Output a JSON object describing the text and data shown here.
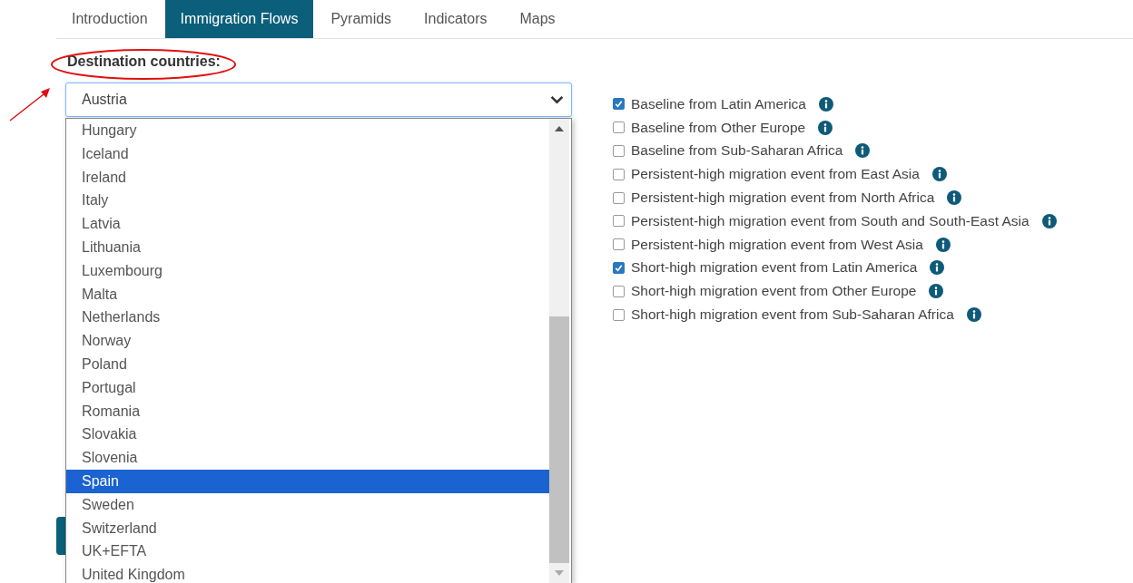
{
  "tabs": [
    {
      "label": "Introduction",
      "selected": false
    },
    {
      "label": "Immigration Flows",
      "selected": true
    },
    {
      "label": "Pyramids",
      "selected": false
    },
    {
      "label": "Indicators",
      "selected": false
    },
    {
      "label": "Maps",
      "selected": false
    }
  ],
  "destination": {
    "label": "Destination countries:",
    "value": "Austria",
    "options": [
      {
        "label": "Hungary",
        "selected": false
      },
      {
        "label": "Iceland",
        "selected": false
      },
      {
        "label": "Ireland",
        "selected": false
      },
      {
        "label": "Italy",
        "selected": false
      },
      {
        "label": "Latvia",
        "selected": false
      },
      {
        "label": "Lithuania",
        "selected": false
      },
      {
        "label": "Luxembourg",
        "selected": false
      },
      {
        "label": "Malta",
        "selected": false
      },
      {
        "label": "Netherlands",
        "selected": false
      },
      {
        "label": "Norway",
        "selected": false
      },
      {
        "label": "Poland",
        "selected": false
      },
      {
        "label": "Portugal",
        "selected": false
      },
      {
        "label": "Romania",
        "selected": false
      },
      {
        "label": "Slovakia",
        "selected": false
      },
      {
        "label": "Slovenia",
        "selected": false
      },
      {
        "label": "Spain",
        "selected": true
      },
      {
        "label": "Sweden",
        "selected": false
      },
      {
        "label": "Switzerland",
        "selected": false
      },
      {
        "label": "UK+EFTA",
        "selected": false
      },
      {
        "label": "United Kingdom",
        "selected": false
      }
    ]
  },
  "scenarios": [
    {
      "label": "Baseline from Latin America",
      "checked": true
    },
    {
      "label": "Baseline from Other Europe",
      "checked": false
    },
    {
      "label": "Baseline from Sub-Saharan Africa",
      "checked": false
    },
    {
      "label": "Persistent-high migration event from East Asia",
      "checked": false
    },
    {
      "label": "Persistent-high migration event from North Africa",
      "checked": false
    },
    {
      "label": "Persistent-high migration event from South and South-East Asia",
      "checked": false
    },
    {
      "label": "Persistent-high migration event from West Asia",
      "checked": false
    },
    {
      "label": "Short-high migration event from Latin America",
      "checked": true
    },
    {
      "label": "Short-high migration event from Other Europe",
      "checked": false
    },
    {
      "label": "Short-high migration event from Sub-Saharan Africa",
      "checked": false
    }
  ]
}
